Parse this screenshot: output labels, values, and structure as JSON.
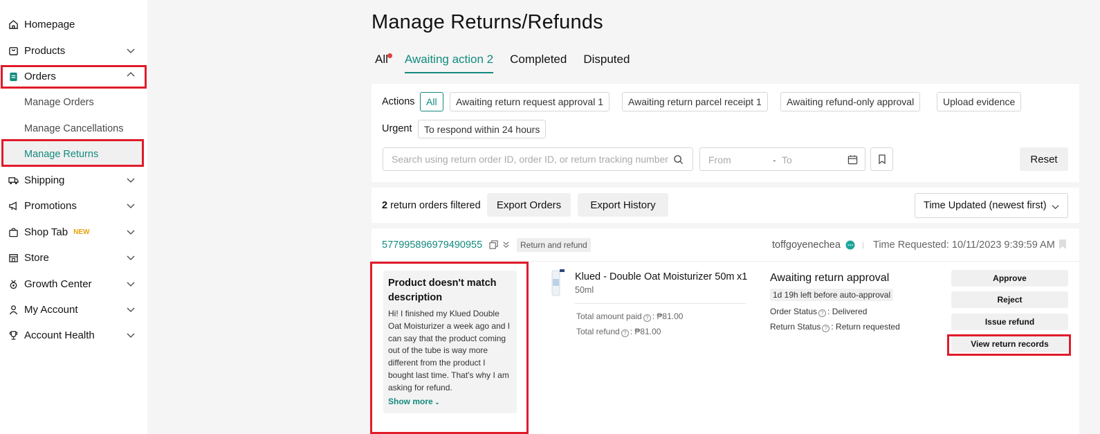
{
  "sidebar": {
    "items": [
      {
        "label": "Homepage",
        "icon": "home-icon"
      },
      {
        "label": "Products",
        "icon": "box-icon"
      },
      {
        "label": "Orders",
        "icon": "clipboard-icon"
      },
      {
        "label": "Shipping",
        "icon": "truck-icon"
      },
      {
        "label": "Promotions",
        "icon": "megaphone-icon"
      },
      {
        "label": "Shop Tab",
        "icon": "bag-icon",
        "badge": "NEW"
      },
      {
        "label": "Store",
        "icon": "store-icon"
      },
      {
        "label": "Growth Center",
        "icon": "medal-icon"
      },
      {
        "label": "My Account",
        "icon": "user-icon"
      },
      {
        "label": "Account Health",
        "icon": "trophy-icon"
      }
    ],
    "order_subitems": [
      "Manage Orders",
      "Manage Cancellations",
      "Manage Returns"
    ],
    "active_subitem": "Manage Returns"
  },
  "page": {
    "title": "Manage Returns/Refunds",
    "tabs": [
      {
        "label": "All",
        "has_dot": true
      },
      {
        "label": "Awaiting action 2",
        "active": true
      },
      {
        "label": "Completed"
      },
      {
        "label": "Disputed"
      }
    ]
  },
  "filters": {
    "actions_label": "Actions",
    "actions": [
      "All",
      "Awaiting return request approval 1",
      "Awaiting return parcel receipt 1",
      "Awaiting refund-only approval",
      "Upload evidence"
    ],
    "urgent_label": "Urgent",
    "urgent": [
      "To respond within 24 hours"
    ],
    "search_placeholder": "Search using return order ID, order ID, or return tracking number",
    "date_from": "From",
    "date_dash": "-",
    "date_to": "To",
    "reset_label": "Reset"
  },
  "toolbar": {
    "count": "2",
    "count_suffix": " return orders filtered",
    "export_orders": "Export Orders",
    "export_history": "Export History",
    "sort": "Time Updated (newest first)"
  },
  "order": {
    "id": "577995896979490955",
    "type": "Return and refund",
    "buyer": "toffgoyenechea",
    "time_requested": "Time Requested: 10/11/2023 9:39:59 AM",
    "reason_title": "Product doesn't match description",
    "reason_text": "Hi! I finished my Klued Double Oat Moisturizer a week ago and I can say that the product coming out of the tube is way more different from the product I bought last time. That's why I am asking for refund.",
    "show_more": "Show more",
    "product_name": "Klued - Double Oat Moisturizer 50ml",
    "product_qty": "x1",
    "product_variant": "50ml",
    "total_paid_label": "Total amount paid",
    "total_paid": ": ₱81.00",
    "total_refund_label": "Total refund",
    "total_refund": ": ₱81.00",
    "status_title": "Awaiting return approval",
    "auto_approval": "1d 19h left before auto-approval",
    "order_status_label": "Order Status",
    "order_status": ": Delivered",
    "return_status_label": "Return Status",
    "return_status": ": Return requested",
    "actions": [
      "Approve",
      "Reject",
      "Issue refund",
      "View return records"
    ]
  },
  "colors": {
    "accent": "#138a7e",
    "highlight": "#e01b2a",
    "new_badge": "#e8a10a"
  }
}
